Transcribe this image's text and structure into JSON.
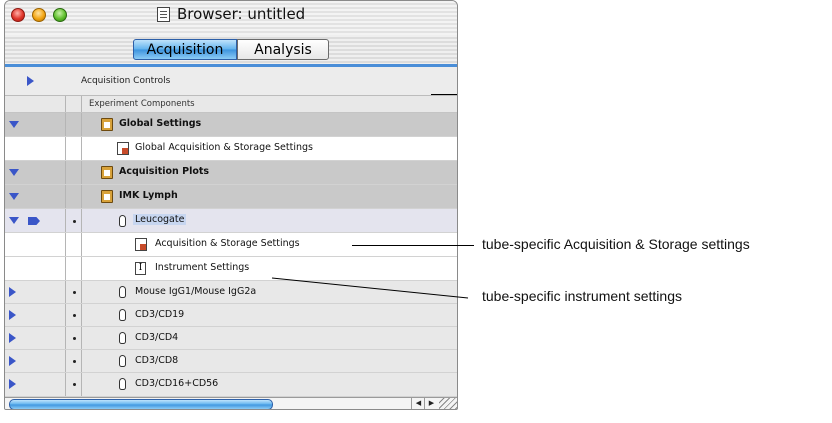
{
  "window": {
    "title": "Browser: untitled"
  },
  "tabs": [
    {
      "label": "Acquisition",
      "active": true
    },
    {
      "label": "Analysis",
      "active": false
    }
  ],
  "acquisition_controls": {
    "label": "Acquisition Controls"
  },
  "experiment_header": {
    "label": "Experiment Components"
  },
  "tree": {
    "global_settings": "Global Settings",
    "global_acq_storage": "Global Acquisition & Storage Settings",
    "acquisition_plots": "Acquisition Plots",
    "specimen": "IMK Lymph",
    "tube_selected": "Leucogate",
    "tube_acq_storage": "Acquisition & Storage Settings",
    "tube_instrument": "Instrument Settings",
    "tubes": [
      "Mouse IgG1/Mouse IgG2a",
      "CD3/CD19",
      "CD3/CD4",
      "CD3/CD8",
      "CD3/CD16+CD56"
    ]
  },
  "annotations": {
    "acq_storage": "tube-specific Acquisition & Storage settings",
    "instrument": "tube-specific instrument settings"
  },
  "colors": {
    "accent": "#3c93de",
    "selected_row": "#e4e4ee",
    "expand_triangle": "#3a56c8"
  }
}
